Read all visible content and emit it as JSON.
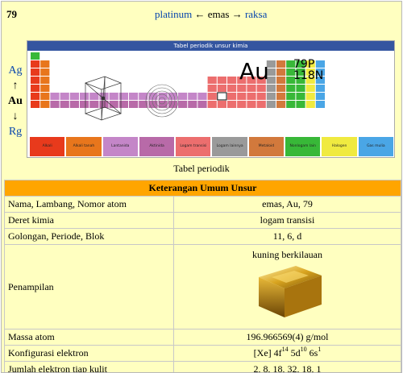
{
  "header": {
    "atomic_number": "79",
    "prev": "platinum",
    "arrow_left": "←",
    "current": "emas",
    "arrow_right": "→",
    "next": "raksa"
  },
  "side_nav": {
    "above": "Ag",
    "up_arrow": "↑",
    "current": "Au",
    "down_arrow": "↓",
    "below": "Rg"
  },
  "periodic_table": {
    "title": "Tabel periodik unsur kimia",
    "symbol": "Au",
    "protons": "79P",
    "neutrons": "118N",
    "caption": "Tabel periodik",
    "legend": [
      {
        "label": "Alkali",
        "color": "#e83a1c"
      },
      {
        "label": "Alkali tanah",
        "color": "#e8761c"
      },
      {
        "label": "Lantanida",
        "color": "#c486c8"
      },
      {
        "label": "Aktinida",
        "color": "#b86aa8"
      },
      {
        "label": "Logam transisi",
        "color": "#ec6e6e"
      },
      {
        "label": "Logam lainnya",
        "color": "#9a9a9a"
      },
      {
        "label": "Metaloid",
        "color": "#d2793c"
      },
      {
        "label": "Nonlogam lain",
        "color": "#38b838"
      },
      {
        "label": "Halogen",
        "color": "#f0ea40"
      },
      {
        "label": "Gas mulia",
        "color": "#4aa6e6"
      }
    ]
  },
  "info": {
    "section_title": "Keterangan Umum Unsur",
    "rows": [
      {
        "label": "Nama, Lambang, Nomor atom",
        "value": "emas, Au, 79"
      },
      {
        "label": "Deret kimia",
        "value": "logam transisi"
      },
      {
        "label": "Golongan, Periode, Blok",
        "value": "11, 6, d"
      }
    ],
    "appearance_label": "Penampilan",
    "appearance_value": "kuning berkilauan",
    "mass_label": "Massa atom",
    "mass_value": "196.966569(4) g/mol",
    "config_label": "Konfigurasi elektron",
    "config_base": "[Xe] 4f",
    "config_sup1": "14",
    "config_mid1": " 5d",
    "config_sup2": "10",
    "config_mid2": " 6s",
    "config_sup3": "1",
    "shell_label": "Jumlah elektron tiap kulit",
    "shell_value": "2, 8, 18, 32, 18, 1"
  }
}
